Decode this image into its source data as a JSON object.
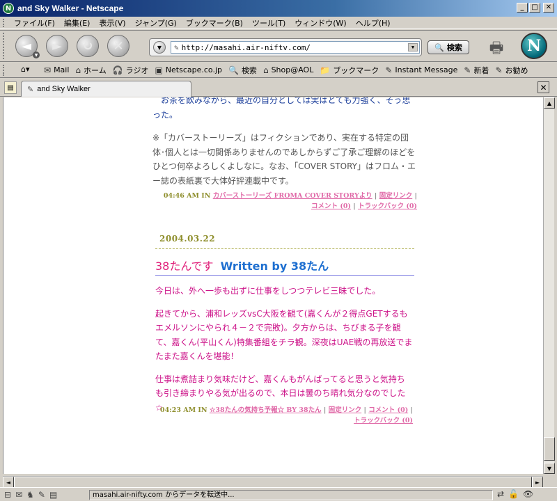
{
  "window": {
    "title": "and Sky Walker - Netscape",
    "app_icon": "N"
  },
  "menu": [
    "ファイル(F)",
    "編集(E)",
    "表示(V)",
    "ジャンプ(G)",
    "ブックマーク(B)",
    "ツール(T)",
    "ウィンドウ(W)",
    "ヘルプ(H)"
  ],
  "nav": {
    "url": "http://masahi.air-niftv.com/",
    "search_label": "検索"
  },
  "personal_toolbar": [
    {
      "icon": "mail-icon",
      "label": "Mail"
    },
    {
      "icon": "home-icon",
      "label": "ホーム"
    },
    {
      "icon": "radio-icon",
      "label": "ラジオ"
    },
    {
      "icon": "my-netscape-icon",
      "label": "Netscape.co.jp"
    },
    {
      "icon": "search-icon",
      "label": "検索"
    },
    {
      "icon": "shop-icon",
      "label": "Shop@AOL"
    },
    {
      "icon": "bookmark-icon",
      "label": "ブックマーク"
    },
    {
      "icon": "instant-message-icon",
      "label": "Instant Message"
    },
    {
      "icon": "new-icon",
      "label": "新着"
    },
    {
      "icon": "recommend-icon",
      "label": "お勧め"
    }
  ],
  "tab": {
    "label": "and Sky Walker"
  },
  "blog": {
    "prev_tail": "お茶を飲みながら、最近の自分としては実はとても力強く、そう思った。",
    "disclaimer": "※「カバーストーリーズ」はフィクションであり、実在する特定の団体･個人とは一切関係ありませんのであしからずご了承ご理解のほどをひとつ何卒よろしくよしなに。なお、「COVER STORY」はフロム・エー誌の表紙裏で大体好評連載中です。",
    "prev_meta": {
      "time": "04:46 AM IN",
      "category": "カバーストーリーズ FROMA COVER STORYより",
      "permalink": "固定リンク",
      "comments": "コメント (0)",
      "trackback": "トラックバック (0)"
    },
    "date": "2004.03.22",
    "post_title": "38たんです",
    "written_by": "Written by 38たん",
    "paragraphs": [
      "今日は、外へ一歩も出ずに仕事をしつつテレビ三昧でした。",
      "起きてから、浦和レッズvsC大阪を観て(嘉くんが２得点GETするもエメルソンにやられ４－２で完敗)。夕方からは、ちびまる子を観て、嘉くん(平山くん)特集番組をチラ観。深夜はUAE戦の再放送でまたまた嘉くんを堪能！",
      "仕事は煮詰まり気味だけど、嘉くんもがんばってると思うと気持ちも引き締まりやる気が出るので、本日は曇のち晴れ気分なのでした☆"
    ],
    "post_meta": {
      "time": "04:23 AM IN",
      "category": "☆38たんの気持ち予報☆ BY 38たん",
      "permalink": "固定リンク",
      "comments": "コメント (0)",
      "trackback": "トラックバック (0)"
    }
  },
  "status": {
    "text": "masahi.air-nifty.com からデータを転送中..."
  },
  "colors": {
    "title_bar": "#0a246a",
    "blog_pink": "#cc1188",
    "blog_blue": "#1a3d9a",
    "meta_olive": "#8f8f2e",
    "link_pink": "#e06aa8"
  }
}
